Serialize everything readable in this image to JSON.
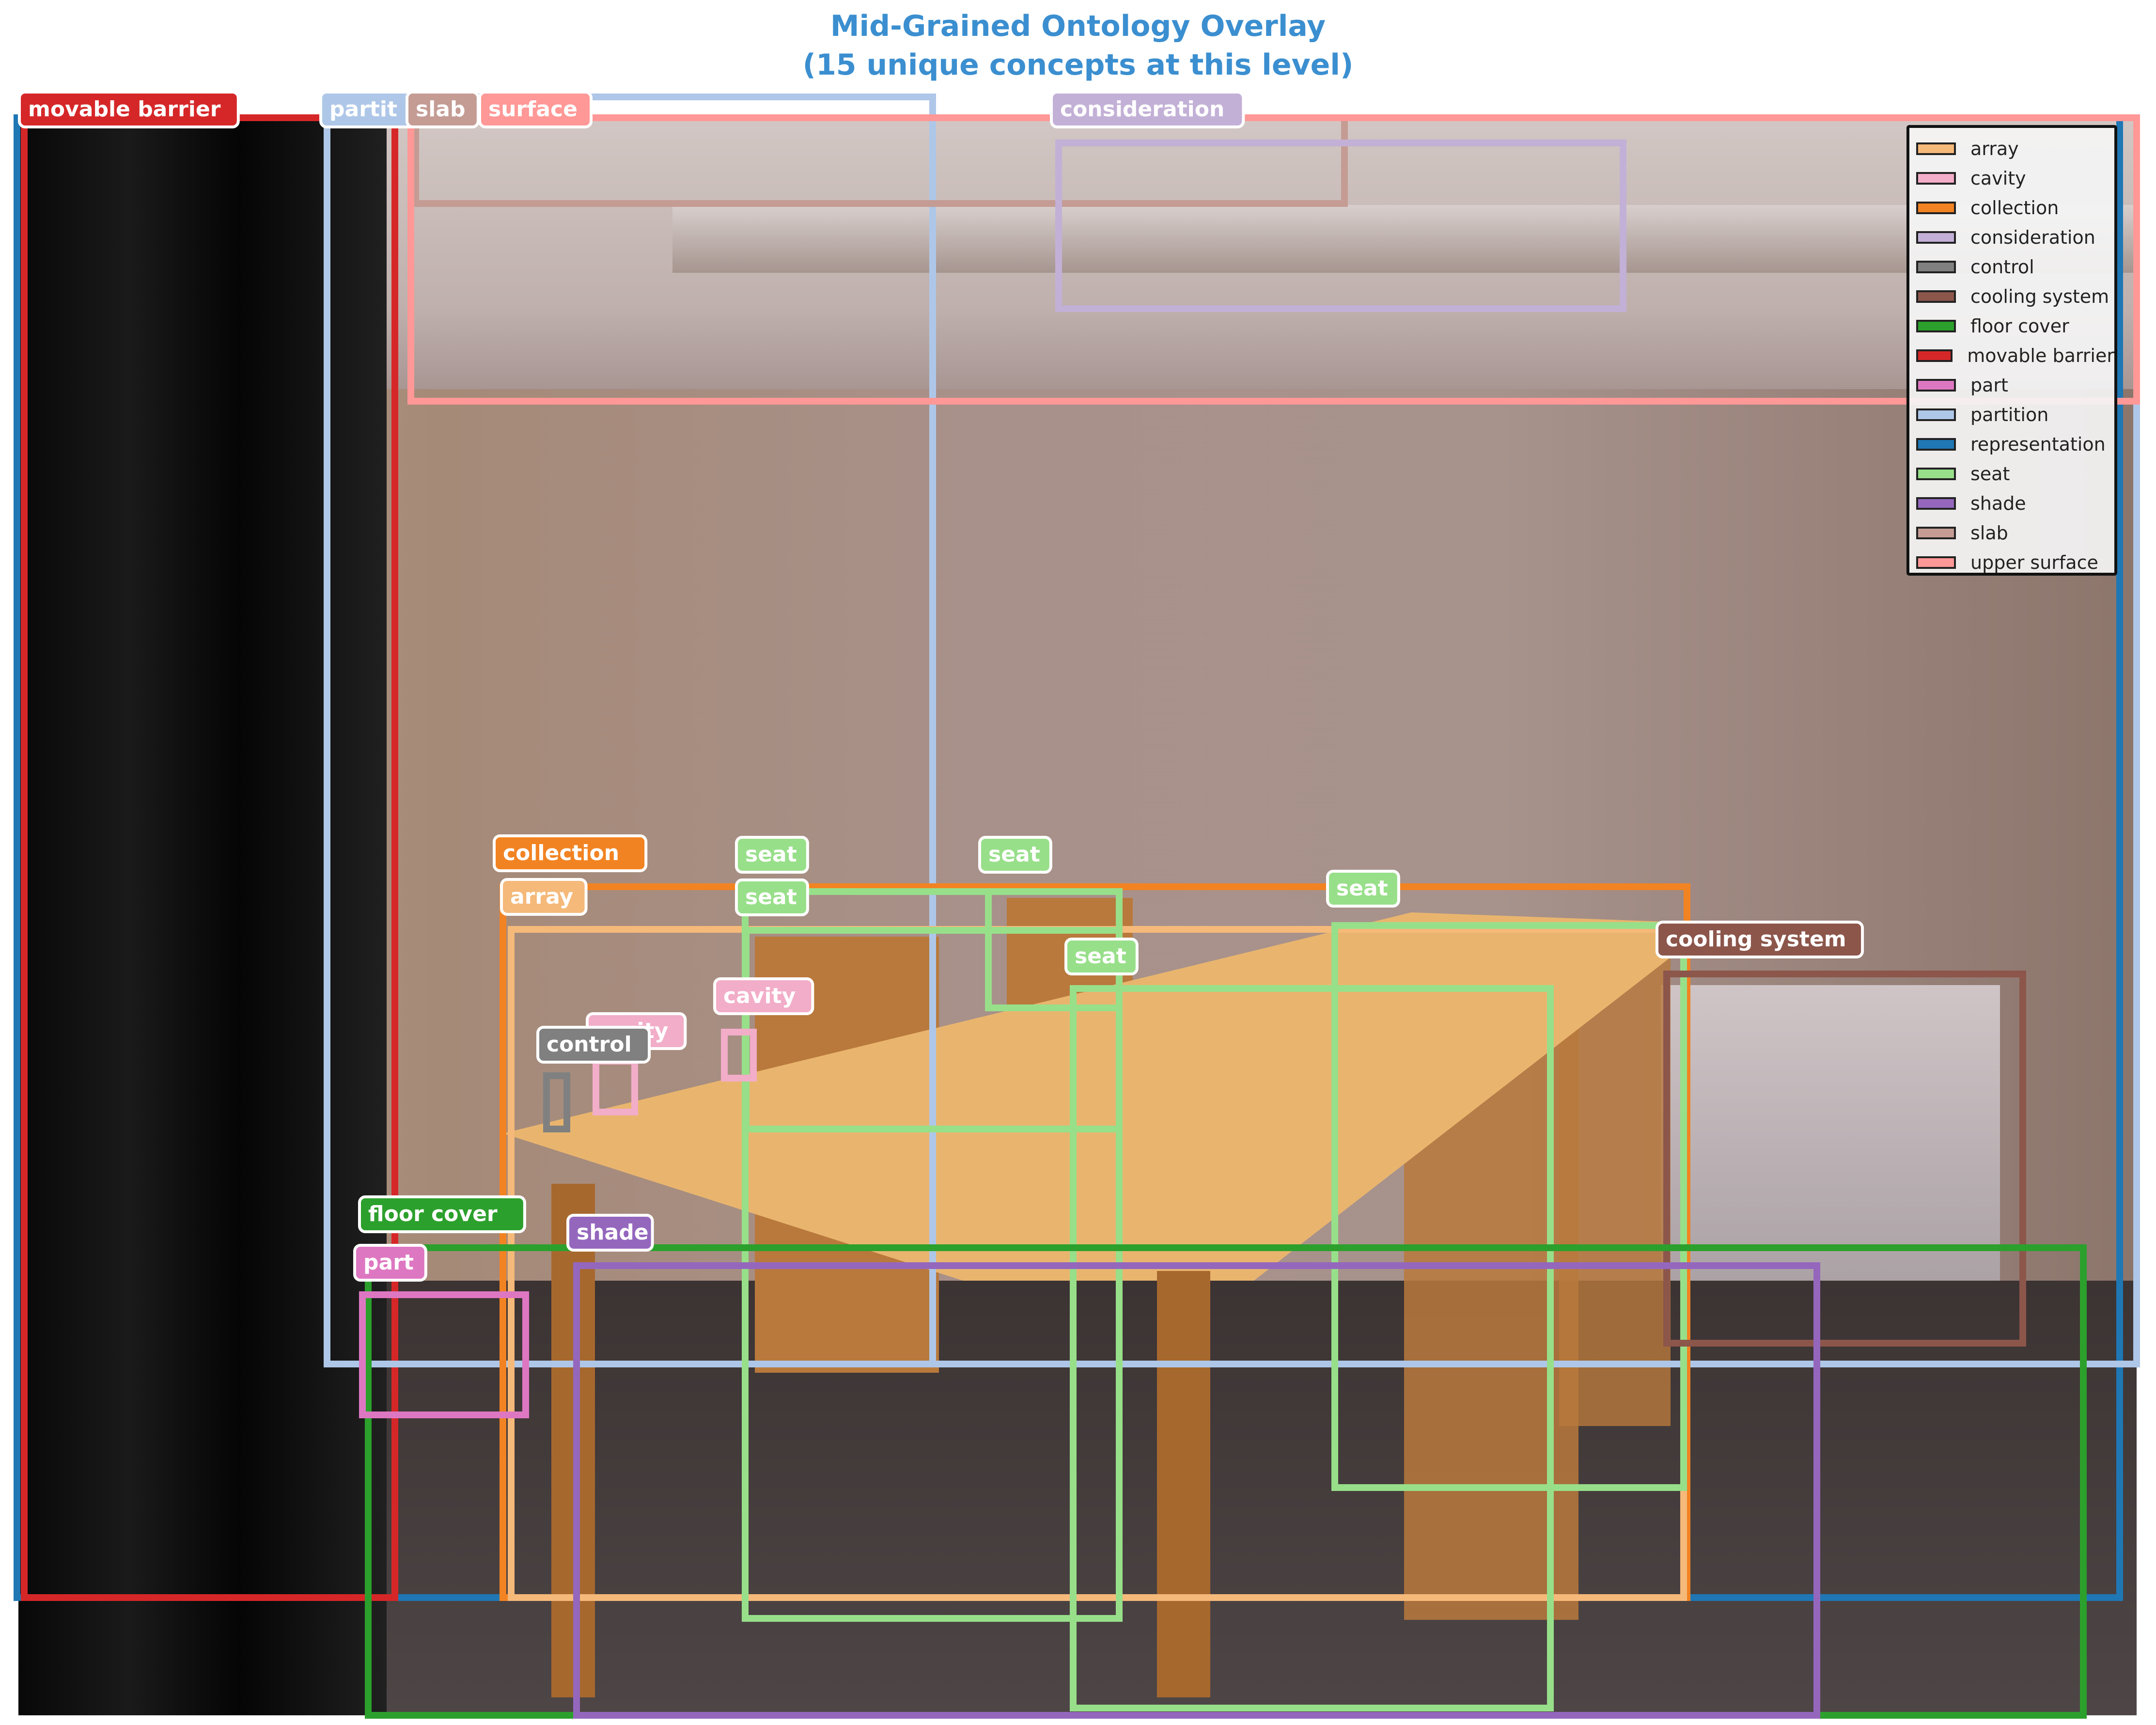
{
  "title_lines": [
    "Mid-Grained Ontology Overlay",
    "(15 unique concepts at this level)"
  ],
  "colors": {
    "array": "#f5b97a",
    "cavity": "#f2adc8",
    "collection": "#f28322",
    "consideration": "#c3b0d6",
    "control": "#808080",
    "cooling_system": "#8c564b",
    "floor_cover": "#2ca02c",
    "movable_barrier": "#d62728",
    "part": "#de77c2",
    "partition": "#aec7e8",
    "representation": "#1f77b4",
    "seat": "#98df8a",
    "shade": "#9467bd",
    "slab": "#c49c94",
    "upper_surface": "#ff9896"
  },
  "legend": [
    {
      "label": "array",
      "color": "#f5b97a"
    },
    {
      "label": "cavity",
      "color": "#f2adc8"
    },
    {
      "label": "collection",
      "color": "#f28322"
    },
    {
      "label": "consideration",
      "color": "#c3b0d6"
    },
    {
      "label": "control",
      "color": "#808080"
    },
    {
      "label": "cooling system",
      "color": "#8c564b"
    },
    {
      "label": "floor cover",
      "color": "#2ca02c"
    },
    {
      "label": "movable barrier",
      "color": "#d62728"
    },
    {
      "label": "part",
      "color": "#de77c2"
    },
    {
      "label": "partition",
      "color": "#aec7e8"
    },
    {
      "label": "representation",
      "color": "#1f77b4"
    },
    {
      "label": "seat",
      "color": "#98df8a"
    },
    {
      "label": "shade",
      "color": "#9467bd"
    },
    {
      "label": "slab",
      "color": "#c49c94"
    },
    {
      "label": "upper surface",
      "color": "#ff9896"
    }
  ],
  "boxes": [
    {
      "label": "",
      "category": "representation"
    },
    {
      "label": "movable barrier",
      "category": "movable_barrier"
    },
    {
      "label": "partit",
      "category": "partition"
    },
    {
      "label": "",
      "category": "partition"
    },
    {
      "label": "slab",
      "category": "slab"
    },
    {
      "label": "surface",
      "category": "upper_surface"
    },
    {
      "label": "consideration",
      "category": "consideration"
    },
    {
      "label": "collection",
      "category": "collection"
    },
    {
      "label": "array",
      "category": "array"
    },
    {
      "label": "seat",
      "category": "seat"
    },
    {
      "label": "seat",
      "category": "seat"
    },
    {
      "label": "seat",
      "category": "seat"
    },
    {
      "label": "seat",
      "category": "seat"
    },
    {
      "label": "seat",
      "category": "seat"
    },
    {
      "label": "cooling system",
      "category": "cooling_system"
    },
    {
      "label": "cavity",
      "category": "cavity"
    },
    {
      "label": "cavity",
      "category": "cavity"
    },
    {
      "label": "control",
      "category": "control"
    },
    {
      "label": "floor cover",
      "category": "floor_cover"
    },
    {
      "label": "shade",
      "category": "shade"
    },
    {
      "label": "part",
      "category": "part"
    }
  ]
}
